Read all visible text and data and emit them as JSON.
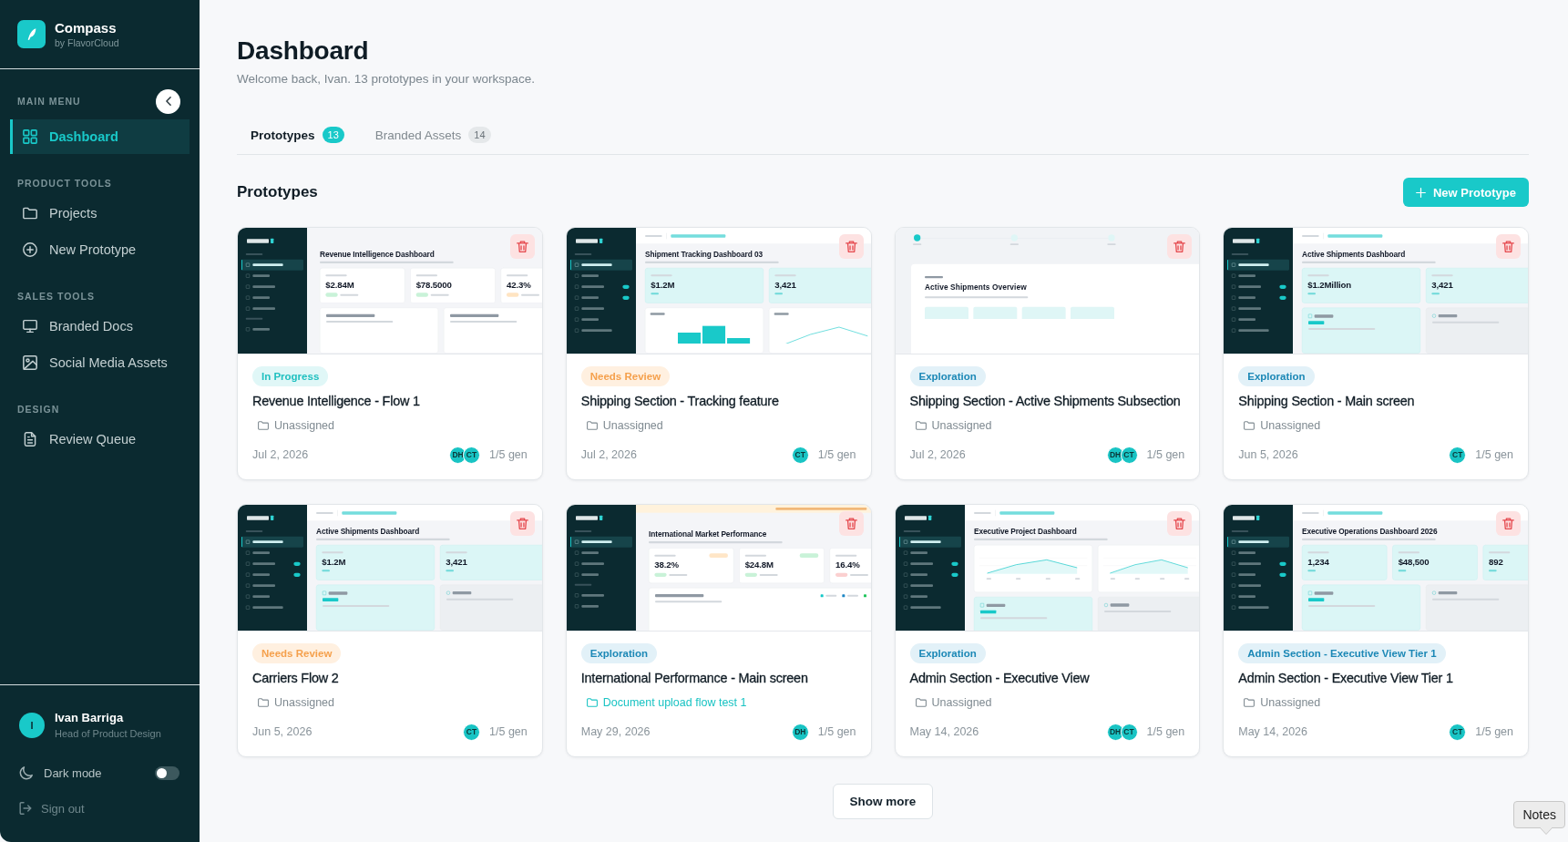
{
  "sidebar": {
    "brand": {
      "name": "Compass",
      "tagline": "by FlavorCloud"
    },
    "sections": [
      {
        "heading": "MAIN MENU",
        "items": [
          {
            "label": "Dashboard",
            "selected": true
          }
        ]
      },
      {
        "heading": "PRODUCT TOOLS",
        "items": [
          {
            "label": "Projects",
            "selected": false
          },
          {
            "label": "New Prototype",
            "selected": false
          }
        ]
      },
      {
        "heading": "SALES TOOLS",
        "items": [
          {
            "label": "Branded Docs",
            "selected": false
          },
          {
            "label": "Social Media Assets",
            "selected": false
          }
        ]
      },
      {
        "heading": "DESIGN",
        "items": [
          {
            "label": "Review Queue",
            "selected": false
          }
        ]
      }
    ],
    "user": {
      "initial": "I",
      "name": "Ivan Barriga",
      "role": "Head of Product Design"
    },
    "dark_mode": {
      "label": "Dark mode",
      "on": false
    },
    "sign_out": "Sign out"
  },
  "header": {
    "title": "Dashboard",
    "subtitle": "Welcome back, Ivan. 13 prototypes in your workspace."
  },
  "tabs": [
    {
      "label": "Prototypes",
      "count": "13",
      "selected": true
    },
    {
      "label": "Branded Assets",
      "count": "14",
      "selected": false
    }
  ],
  "section": {
    "title": "Prototypes",
    "action": "New Prototype"
  },
  "cards": [
    {
      "thumbnail": {
        "kind": "metrics",
        "title": "Revenue Intelligence Dashboard",
        "stats": [
          "$2.84M",
          "$78.5000",
          "42.3%"
        ]
      },
      "status": {
        "label": "In Progress",
        "kind": "progress"
      },
      "title": "Revenue Intelligence - Flow 1",
      "project": {
        "label": "Unassigned",
        "assigned": false
      },
      "date": "Jul 2, 2026",
      "collaborators": [
        "DH",
        "CT"
      ],
      "generations": "1/5 gen"
    },
    {
      "thumbnail": {
        "kind": "charts",
        "title": "Shipment Tracking Dashboard 03",
        "stats": [
          "$1.2M",
          "3,421"
        ]
      },
      "status": {
        "label": "Needs Review",
        "kind": "review"
      },
      "title": "Shipping Section - Tracking feature",
      "project": {
        "label": "Unassigned",
        "assigned": false
      },
      "date": "Jul 2, 2026",
      "collaborators": [
        "CT"
      ],
      "generations": "1/5 gen"
    },
    {
      "thumbnail": {
        "kind": "wizard",
        "steps": [
          {
            "selected": true
          },
          {
            "selected": false
          },
          {
            "selected": false
          }
        ],
        "title": "Active Shipments Overview"
      },
      "status": {
        "label": "Exploration",
        "kind": "exploration"
      },
      "title": "Shipping Section - Active Shipments Subsection",
      "project": {
        "label": "Unassigned",
        "assigned": false
      },
      "date": "Jul 2, 2026",
      "collaborators": [
        "DH",
        "CT"
      ],
      "generations": "1/5 gen"
    },
    {
      "thumbnail": {
        "kind": "overview",
        "title": "Active Shipments Dashboard",
        "stats": [
          "$1.2Million",
          "3,421"
        ]
      },
      "status": {
        "label": "Exploration",
        "kind": "exploration"
      },
      "title": "Shipping Section - Main screen",
      "project": {
        "label": "Unassigned",
        "assigned": false
      },
      "date": "Jun 5, 2026",
      "collaborators": [
        "CT"
      ],
      "generations": "1/5 gen"
    },
    {
      "thumbnail": {
        "kind": "overview",
        "title": "Active Shipments Dashboard",
        "stats": [
          "$1.2M",
          "3,421"
        ]
      },
      "status": {
        "label": "Needs Review",
        "kind": "review"
      },
      "title": "Carriers Flow 2",
      "project": {
        "label": "Unassigned",
        "assigned": false
      },
      "date": "Jun 5, 2026",
      "collaborators": [
        "CT"
      ],
      "generations": "1/5 gen"
    },
    {
      "thumbnail": {
        "kind": "market",
        "title": "International Market Performance",
        "stats": [
          "38.2%",
          "$24.8M",
          "16.4%"
        ]
      },
      "status": {
        "label": "Exploration",
        "kind": "exploration"
      },
      "title": "International Performance - Main screen",
      "project": {
        "label": "Document upload flow test 1",
        "assigned": true
      },
      "date": "May 29, 2026",
      "collaborators": [
        "DH"
      ],
      "generations": "1/5 gen"
    },
    {
      "thumbnail": {
        "kind": "trends",
        "title": "Executive Project Dashboard"
      },
      "status": {
        "label": "Exploration",
        "kind": "exploration"
      },
      "title": "Admin Section - Executive View",
      "project": {
        "label": "Unassigned",
        "assigned": false
      },
      "date": "May 14, 2026",
      "collaborators": [
        "DH",
        "CT"
      ],
      "generations": "1/5 gen"
    },
    {
      "thumbnail": {
        "kind": "overview",
        "title": "Executive Operations Dashboard 2026",
        "stats": [
          "1,234",
          "$48,500",
          "892"
        ]
      },
      "status": {
        "label": "Admin Section - Executive View Tier 1",
        "kind": "exploration"
      },
      "title": "Admin Section - Executive View Tier 1",
      "project": {
        "label": "Unassigned",
        "assigned": false
      },
      "date": "May 14, 2026",
      "collaborators": [
        "CT"
      ],
      "generations": "1/5 gen"
    }
  ],
  "show_more": "Show more",
  "notes_tooltip": "Notes"
}
